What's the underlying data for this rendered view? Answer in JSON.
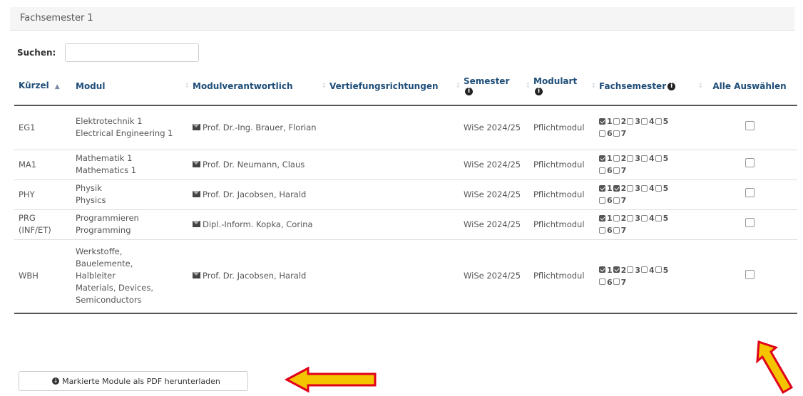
{
  "panel": {
    "title": "Fachsemester 1"
  },
  "search": {
    "label": "Suchen:",
    "value": ""
  },
  "columns": [
    {
      "label": "Kürzel",
      "sort": "asc"
    },
    {
      "label": "Modul",
      "sort": "none"
    },
    {
      "label": "Modulverantwortlich",
      "sort": "none"
    },
    {
      "label": "Vertiefungsrichtungen",
      "sort": "none"
    },
    {
      "label": "Semester",
      "sort": "none",
      "info": true
    },
    {
      "label": "Modulart",
      "sort": "none",
      "info": true
    },
    {
      "label": "Fachsemester",
      "sort": "none",
      "info": true
    },
    {
      "label": "Alle Auswählen",
      "sort": "none"
    }
  ],
  "rows": [
    {
      "kurzel": "EG1",
      "modul": [
        "Elektrotechnik 1",
        "Electrical Engineering 1"
      ],
      "verantwortlich": "Prof. Dr.-Ing. Brauer, Florian",
      "vertiefung": "",
      "semester": "WiSe 2024/25",
      "modulart": "Pflichtmodul",
      "fachsemester_checked": [
        1
      ],
      "selected": false
    },
    {
      "kurzel": "MA1",
      "modul": [
        "Mathematik 1",
        "Mathematics 1"
      ],
      "verantwortlich": "Prof. Dr. Neumann, Claus",
      "vertiefung": "",
      "semester": "WiSe 2024/25",
      "modulart": "Pflichtmodul",
      "fachsemester_checked": [
        1
      ],
      "selected": false
    },
    {
      "kurzel": "PHY",
      "modul": [
        "Physik",
        "Physics"
      ],
      "verantwortlich": "Prof. Dr. Jacobsen, Harald",
      "vertiefung": "",
      "semester": "WiSe 2024/25",
      "modulart": "Pflichtmodul",
      "fachsemester_checked": [
        1,
        2
      ],
      "selected": false
    },
    {
      "kurzel": "PRG (INF/ET)",
      "modul": [
        "Programmieren",
        "Programming"
      ],
      "verantwortlich": "Dipl.-Inform. Kopka, Corina",
      "vertiefung": "",
      "semester": "WiSe 2024/25",
      "modulart": "Pflichtmodul",
      "fachsemester_checked": [
        1
      ],
      "selected": false
    },
    {
      "kurzel": "WBH",
      "modul": [
        "Werkstoffe, Bauelemente, Halbleiter",
        "Materials, Devices, Semiconductors"
      ],
      "verantwortlich": "Prof. Dr. Jacobsen, Harald",
      "vertiefung": "",
      "semester": "WiSe 2024/25",
      "modulart": "Pflichtmodul",
      "fachsemester_checked": [
        1,
        2
      ],
      "selected": false
    }
  ],
  "fachsemester_options": [
    1,
    2,
    3,
    4,
    5,
    6,
    7
  ],
  "pdf_button": {
    "label": "Markierte Module als PDF herunterladen",
    "icon": "download-icon"
  },
  "colors": {
    "header_text": "#1f4e79",
    "arrow_fill": "#f5c400",
    "arrow_stroke": "#e0001a"
  }
}
